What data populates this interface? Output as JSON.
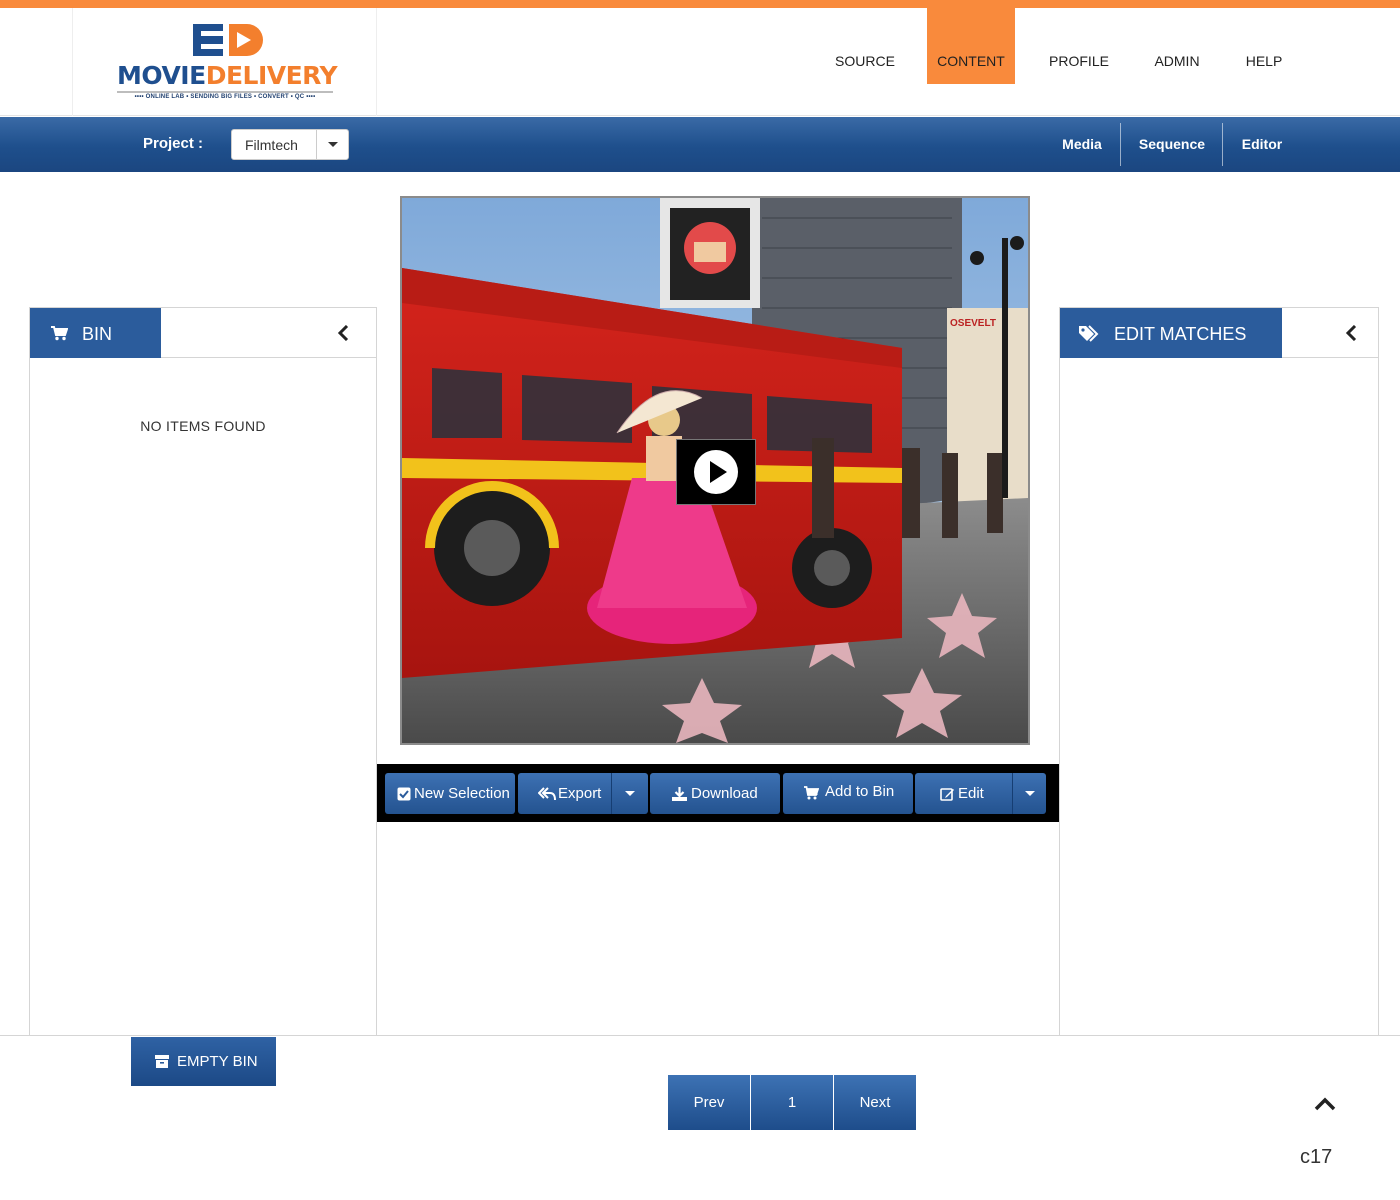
{
  "brand": {
    "word_part1": "MOVIE",
    "word_part2": "DELIVERY",
    "tagline": "•••• ONLINE LAB • SENDING BIG FILES • CONVERT • QC ••••",
    "primary_color": "#1f4f8f",
    "accent_color": "#f98a3c"
  },
  "nav": {
    "items": [
      {
        "label": "SOURCE"
      },
      {
        "label": "CONTENT",
        "active": true
      },
      {
        "label": "PROFILE"
      },
      {
        "label": "ADMIN"
      },
      {
        "label": "HELP"
      }
    ]
  },
  "subbar": {
    "project_label": "Project :",
    "project_value": "Filmtech",
    "links": [
      "Media",
      "Sequence",
      "Editor"
    ]
  },
  "bin_panel": {
    "title": "BIN",
    "icon": "cart-icon",
    "empty_message": "NO ITEMS FOUND"
  },
  "edit_panel": {
    "title": "EDIT MATCHES",
    "icon": "tags-icon"
  },
  "video": {
    "thumbnail": "photo of a red double-decker bus and a woman in a pink dress on a star-studded sidewalk",
    "play_icon": "play-icon"
  },
  "toolbar": {
    "new_selection": "New Selection",
    "export": "Export",
    "download": "Download",
    "add_to_bin": "Add to Bin",
    "edit": "Edit"
  },
  "empty_bin": "EMPTY BIN",
  "pagination": {
    "prev": "Prev",
    "page": "1",
    "next": "Next"
  },
  "footer_code": "c17"
}
